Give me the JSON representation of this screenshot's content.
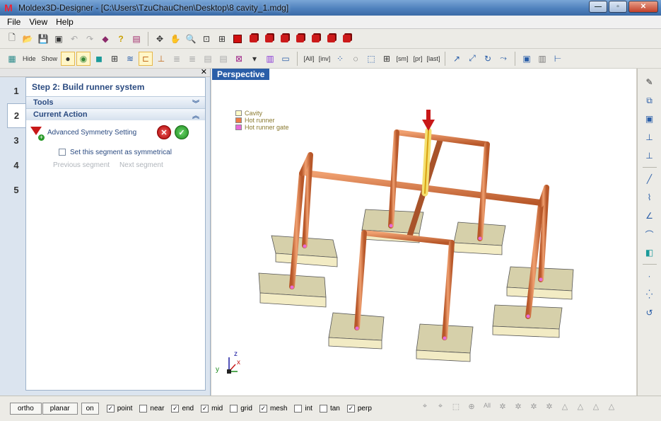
{
  "window": {
    "title": "Moldex3D-Designer - [C:\\Users\\TzuChauChen\\Desktop\\8 cavity_1.mdg]",
    "controls": [
      "—",
      "▫",
      "✕"
    ]
  },
  "menu": {
    "items": [
      "File",
      "View",
      "Help"
    ]
  },
  "toolbar2": {
    "hide_label": "Hide",
    "show_label": "Show"
  },
  "left_panel": {
    "step_title": "Step 2: Build runner system",
    "steps": [
      "1",
      "2",
      "3",
      "4",
      "5"
    ],
    "tools_label": "Tools",
    "current_action_label": "Current Action",
    "action_name": "Advanced Symmetry Setting",
    "checkbox_label": "Set this segment as symmetrical",
    "previous_segment": "Previous segment",
    "next_segment": "Next segment"
  },
  "viewport": {
    "tab": "Perspective",
    "legend": [
      {
        "label": "Cavity",
        "color": "#fffbc8"
      },
      {
        "label": "Hot runner",
        "color": "#ee7a44"
      },
      {
        "label": "Hot runner gate",
        "color": "#e86ad8"
      }
    ],
    "axis": {
      "x": "x",
      "y": "y",
      "z": "z"
    }
  },
  "statusbar": {
    "ortho": "ortho",
    "planar": "planar",
    "on": "on",
    "snaps": [
      {
        "label": "point",
        "checked": true
      },
      {
        "label": "near",
        "checked": false
      },
      {
        "label": "end",
        "checked": true
      },
      {
        "label": "mid",
        "checked": true
      },
      {
        "label": "grid",
        "checked": false
      },
      {
        "label": "mesh",
        "checked": true
      },
      {
        "label": "int",
        "checked": false
      },
      {
        "label": "tan",
        "checked": false
      },
      {
        "label": "perp",
        "checked": true
      }
    ]
  },
  "colors": {
    "runner": "#e0824f",
    "cavity_top": "#d9d4b0",
    "cavity_side": "#f0e8c0",
    "accent_blue": "#2a5ea8"
  }
}
